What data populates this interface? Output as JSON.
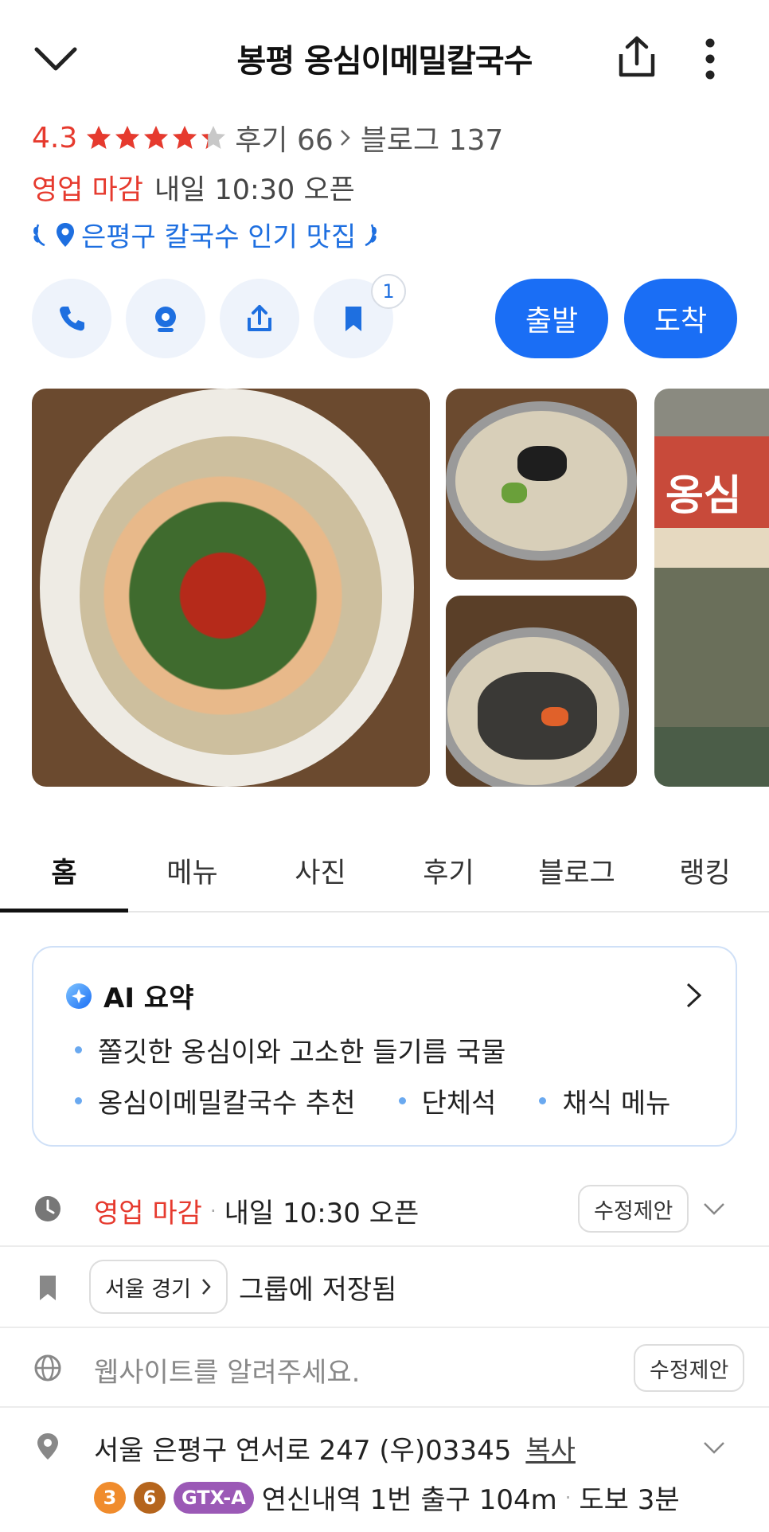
{
  "header": {
    "title": "봉평 옹심이메밀칼국수"
  },
  "rating": {
    "score": "4.3",
    "stars_value": 4.3,
    "reviews_label": "후기 66",
    "blog_label": "블로그 137"
  },
  "hours": {
    "status": "영업 마감",
    "next": "내일 10:30 오픈"
  },
  "award": {
    "text": "은평구 칼국수 인기 맛집"
  },
  "actions": {
    "save_count": "1",
    "depart": "출발",
    "arrive": "도착"
  },
  "photos": {
    "sign_text": "옹심"
  },
  "tabs": [
    "홈",
    "메뉴",
    "사진",
    "후기",
    "블로그",
    "랭킹"
  ],
  "ai_summary": {
    "title": "AI 요약",
    "bullets_line1": [
      "쫄깃한 옹심이와 고소한 들기름 국물"
    ],
    "bullets_line2": [
      "옹심이메밀칼국수 추천",
      "단체석",
      "채식 메뉴"
    ]
  },
  "info": {
    "hours_status": "영업 마감",
    "hours_next": "내일 10:30 오픈",
    "suggest_edit": "수정제안",
    "group_chip": "서울 경기",
    "group_saved": "그룹에 저장됨",
    "website_placeholder": "웹사이트를 알려주세요.",
    "address": "서울 은평구 연서로 247 (우)03345",
    "copy": "복사",
    "line3": "3",
    "line6": "6",
    "gtx": "GTX-A",
    "station": "연신내역 1번 출구 104m",
    "walk": "도보 3분"
  },
  "colors": {
    "accent": "#1a6ef5",
    "closed": "#e63a2e",
    "star": "#e63a2e",
    "line3": "#f08c2d",
    "line6": "#b5651d",
    "gtx": "#9b59b6"
  }
}
